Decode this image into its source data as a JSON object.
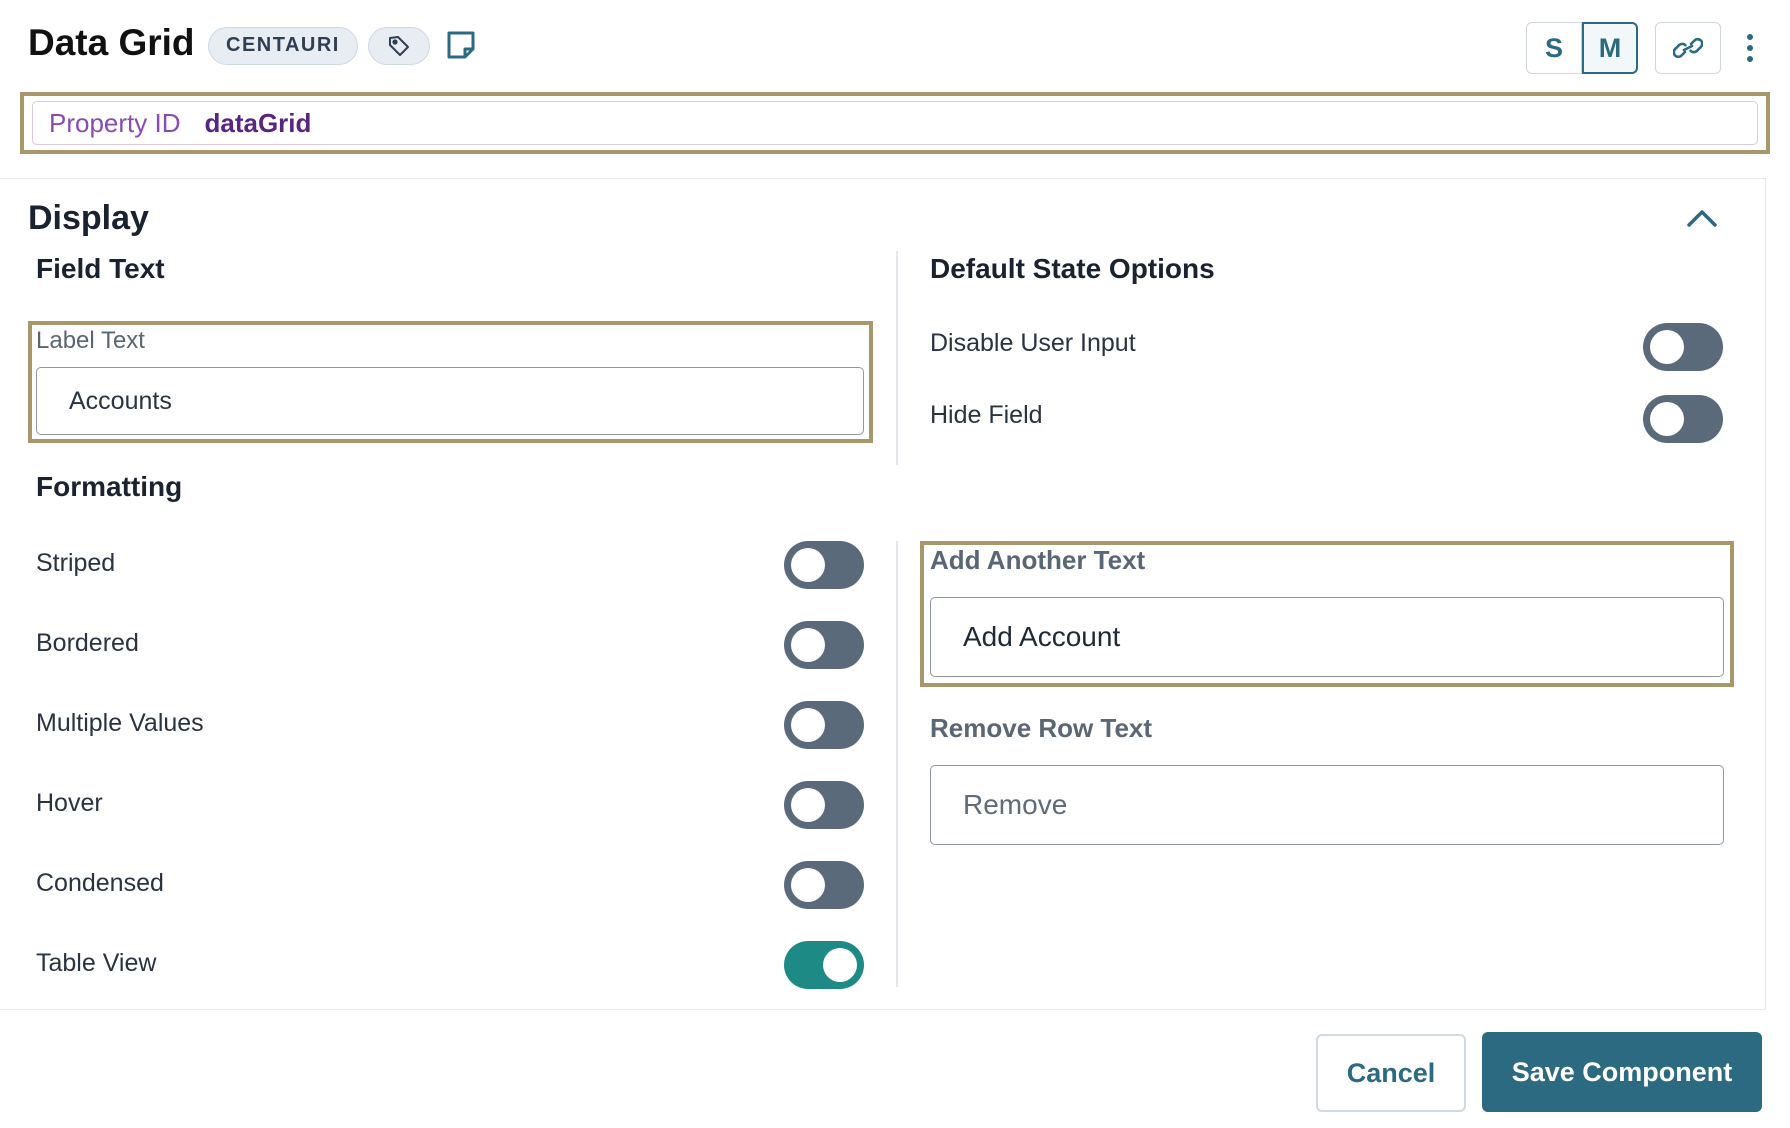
{
  "header": {
    "title": "Data Grid",
    "badge": "CENTAURI",
    "tag_icon": "tag-icon",
    "note_icon": "sticky-note-icon",
    "sizes": [
      "S",
      "M"
    ],
    "active_size": "M",
    "link_icon": "link-icon",
    "more_icon": "kebab-menu-icon"
  },
  "property": {
    "label": "Property ID",
    "value": "dataGrid"
  },
  "display": {
    "title": "Display",
    "collapse_icon": "chevron-up-icon",
    "field_text": {
      "title": "Field Text",
      "label_text_label": "Label Text",
      "label_text_value": "Accounts"
    },
    "formatting": {
      "title": "Formatting",
      "toggles": [
        {
          "label": "Striped",
          "on": false
        },
        {
          "label": "Bordered",
          "on": false
        },
        {
          "label": "Multiple Values",
          "on": false
        },
        {
          "label": "Hover",
          "on": false
        },
        {
          "label": "Condensed",
          "on": false
        },
        {
          "label": "Table View",
          "on": true
        }
      ]
    },
    "default_state": {
      "title": "Default State Options",
      "toggles": [
        {
          "label": "Disable User Input",
          "on": false
        },
        {
          "label": "Hide Field",
          "on": false
        }
      ]
    },
    "add_another": {
      "label": "Add Another Text",
      "value": "Add Account"
    },
    "remove_row": {
      "label": "Remove Row Text",
      "placeholder": "Remove"
    }
  },
  "footer": {
    "cancel_label": "Cancel",
    "save_label": "Save Component"
  },
  "colors": {
    "accent": "#2b6a80",
    "highlight_border": "#a8976a",
    "toggle_off": "#5b6a7b",
    "toggle_on": "#1e8a85",
    "property_label": "#8a4bb0"
  }
}
